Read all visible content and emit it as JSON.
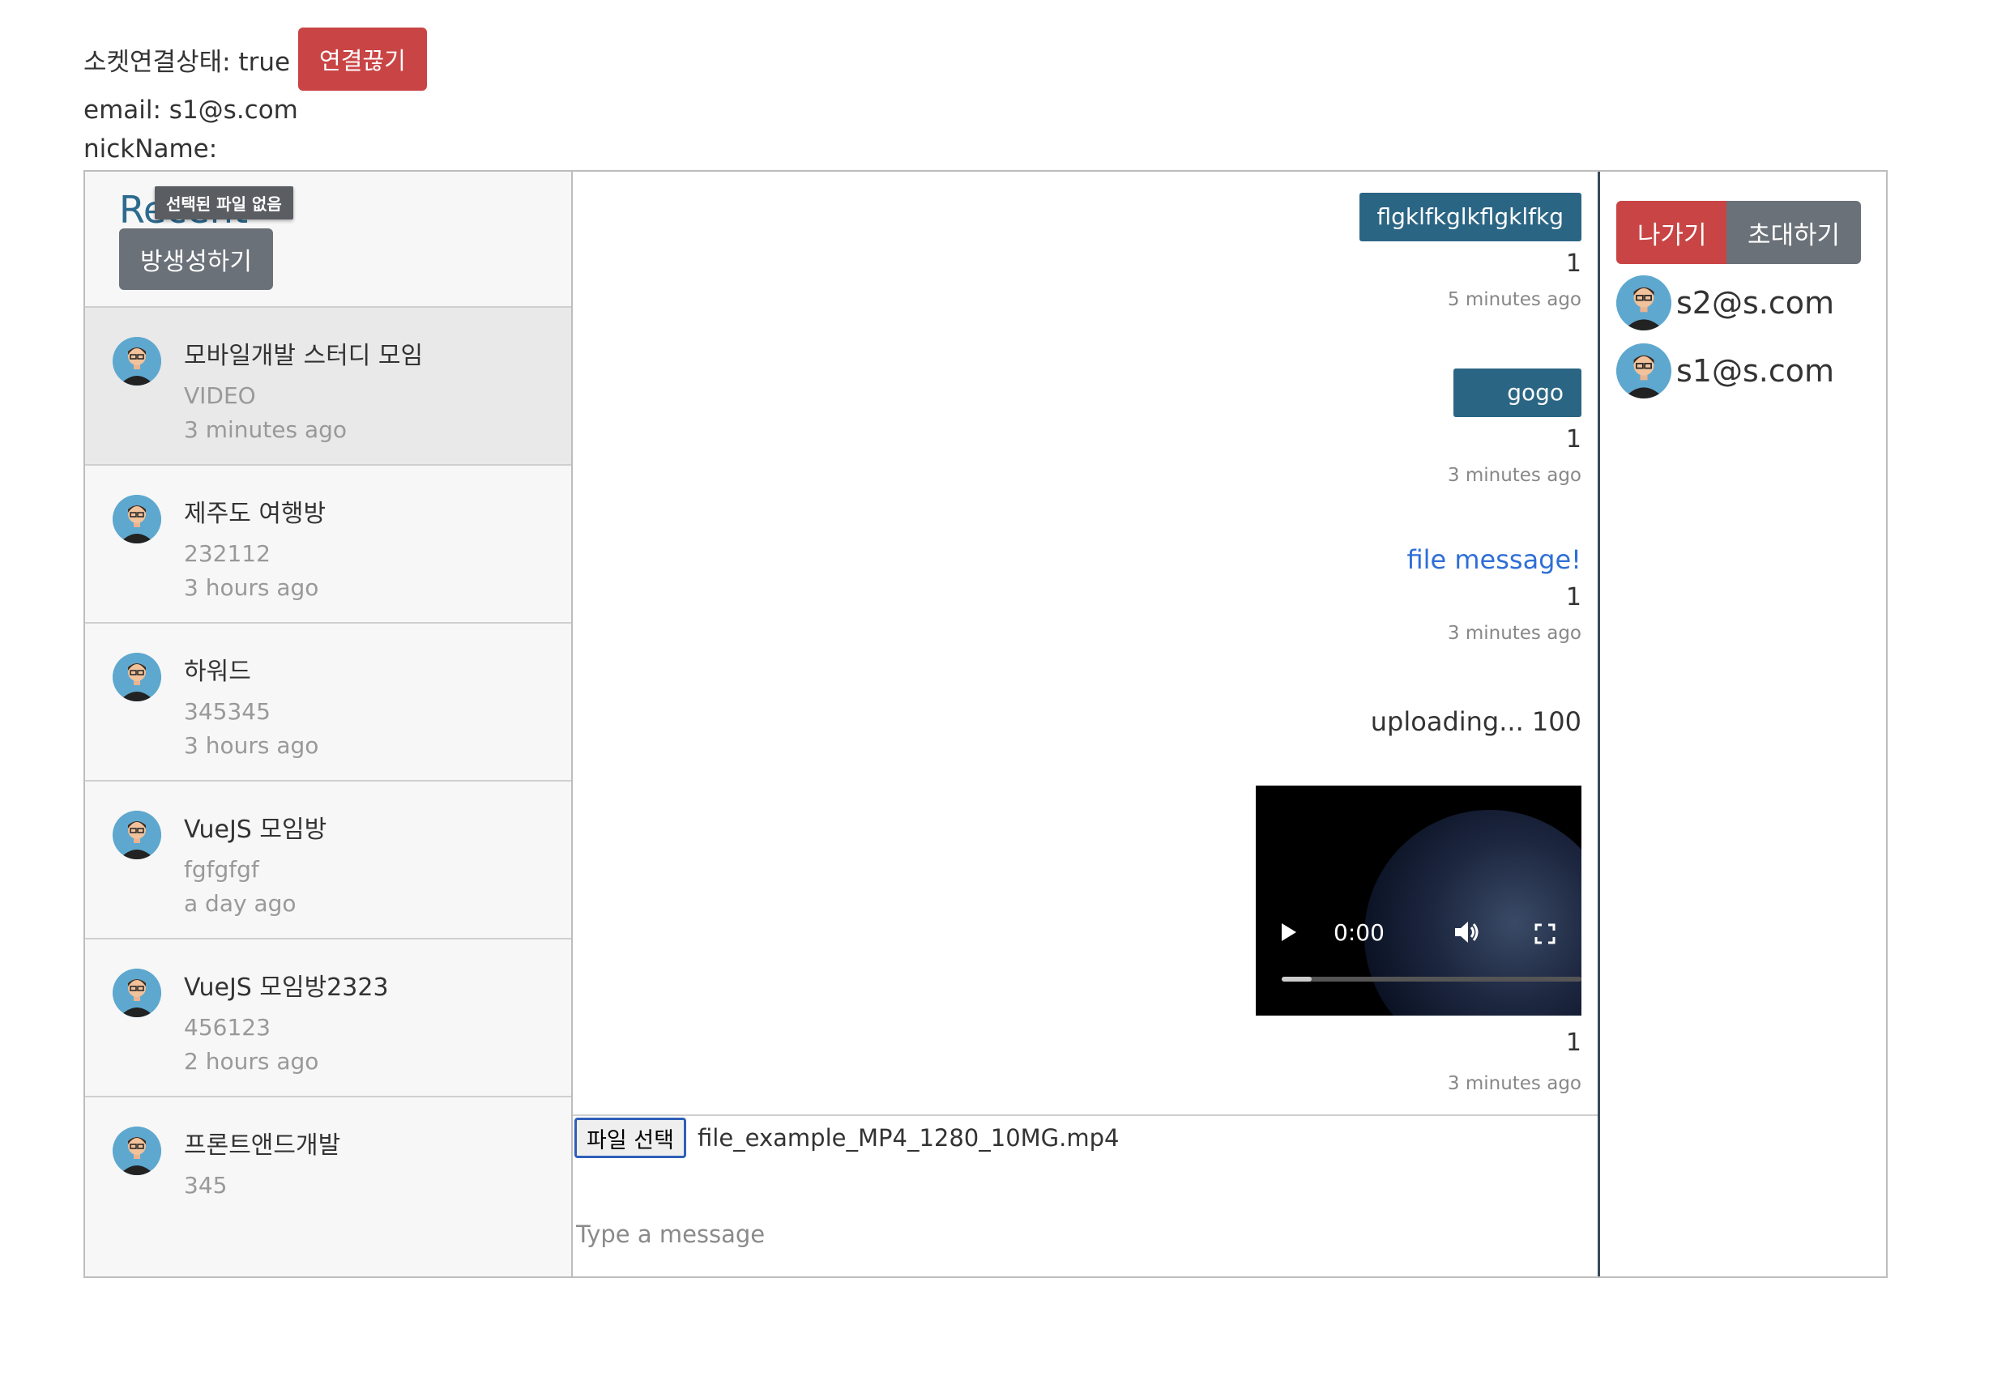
{
  "header": {
    "socket_label": "소켓연결상태: true",
    "disconnect_label": "연결끊기",
    "email_line": "email: s1@s.com",
    "nickname_line": "nickName:"
  },
  "sidebar": {
    "title": "Recent",
    "file_tooltip": "선택된 파일 없음",
    "create_room_label": "방생성하기",
    "rooms": [
      {
        "name": "모바일개발 스터디 모임",
        "last_message": "VIDEO",
        "time": "3 minutes ago"
      },
      {
        "name": "제주도 여행방",
        "last_message": "232112",
        "time": "3 hours ago"
      },
      {
        "name": "하워드",
        "last_message": "345345",
        "time": "3 hours ago"
      },
      {
        "name": "VueJS 모임방",
        "last_message": "fgfgfgf",
        "time": "a day ago"
      },
      {
        "name": "VueJS 모임방2323",
        "last_message": "456123",
        "time": "2 hours ago"
      },
      {
        "name": "프론트앤드개발",
        "last_message": "345",
        "time": ""
      }
    ]
  },
  "chat": {
    "messages": [
      {
        "text": "flgklfkglkflgklfkg",
        "count": "1",
        "time": "5 minutes ago"
      },
      {
        "text": "gogo",
        "count": "1",
        "time": "3 minutes ago"
      },
      {
        "text": "file message!",
        "count": "1",
        "time": "3 minutes ago"
      },
      {
        "upload": "uploading... 100"
      },
      {
        "video_time": "0:00",
        "count": "1",
        "time": "3 minutes ago",
        "progress": 0.1
      }
    ]
  },
  "composer": {
    "file_button": "파일 선택",
    "file_name": "file_example_MP4_1280_10MG.mp4",
    "placeholder": "Type a message"
  },
  "members_panel": {
    "leave_label": "나가기",
    "invite_label": "초대하기",
    "members": [
      "s2@s.com",
      "s1@s.com"
    ]
  },
  "colors": {
    "danger": "#c94444",
    "secondary": "#6b7178",
    "bubble": "#2b6584",
    "link": "#2f6fd6"
  }
}
